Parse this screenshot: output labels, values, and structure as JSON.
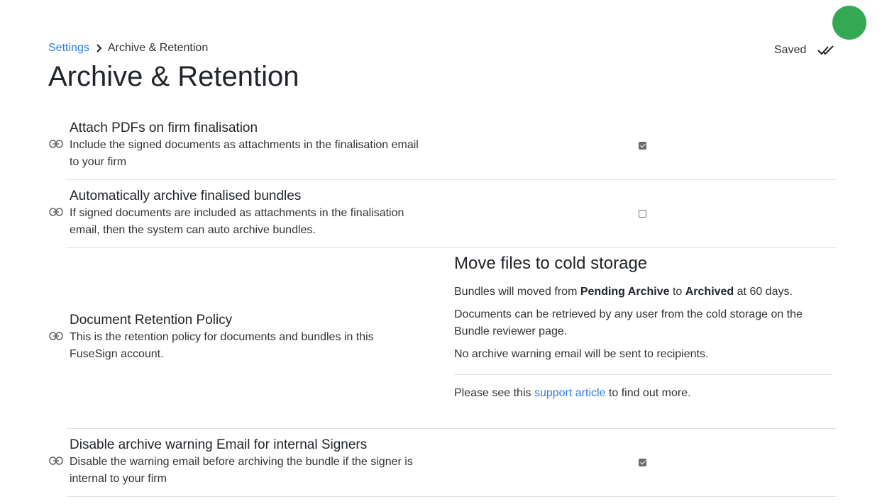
{
  "header": {
    "breadcrumb_root": "Settings",
    "breadcrumb_current": "Archive & Retention",
    "title": "Archive & Retention",
    "saved_label": "Saved"
  },
  "settings": [
    {
      "title": "Attach PDFs on firm finalisation",
      "desc_line1": "Include the signed documents as attachments in the finalisation email",
      "desc_line2": "to your firm",
      "checked": true
    },
    {
      "title": "Automatically archive finalised bundles",
      "desc_line1": "If signed documents are included as attachments in the finalisation",
      "desc_line2": "email, then the system can auto archive bundles.",
      "checked": false
    },
    {
      "title": "Document Retention Policy",
      "desc_line1": "This is the retention policy for documents and bundles in this",
      "desc_line2": "FuseSign account."
    },
    {
      "title": "Disable archive warning Email for internal Signers",
      "desc_line1": "Disable the warning email before archiving the bundle if the signer is",
      "desc_line2": "internal to your firm",
      "checked": true
    }
  ],
  "retention": {
    "heading": "Move files to cold storage",
    "line1_a": "Bundles will moved from ",
    "line1_b": "Pending Archive",
    "line1_c": " to ",
    "line1_d": "Archived",
    "line1_e": " at 60 days.",
    "line2": "Documents can be retrieved by any user from the cold storage on the Bundle reviewer page.",
    "line3": "No archive warning email will be sent to recipients.",
    "support_pre": "Please see this ",
    "support_link": "support article",
    "support_post": " to find out more."
  },
  "colors": {
    "accent": "#2c7be5",
    "avatar": "#34a853"
  }
}
